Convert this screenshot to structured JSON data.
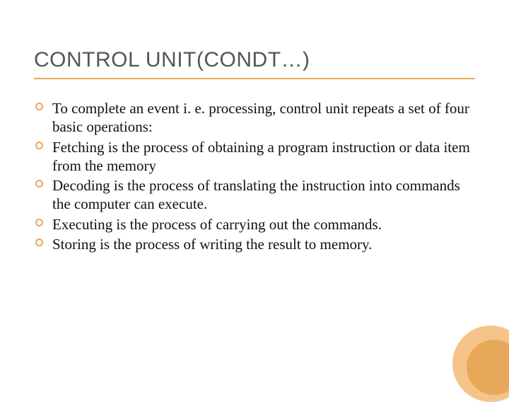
{
  "slide": {
    "title": "CONTROL UNIT(CONDT…)",
    "bullets": [
      "To complete an event i. e. processing, control unit repeats a set of four basic operations:",
      "Fetching is the process of obtaining a program instruction or data item from the memory",
      "Decoding is the process of translating the instruction into commands the computer can execute.",
      "Executing is the process of carrying out the commands.",
      "Storing is the process of writing the result to memory."
    ]
  }
}
